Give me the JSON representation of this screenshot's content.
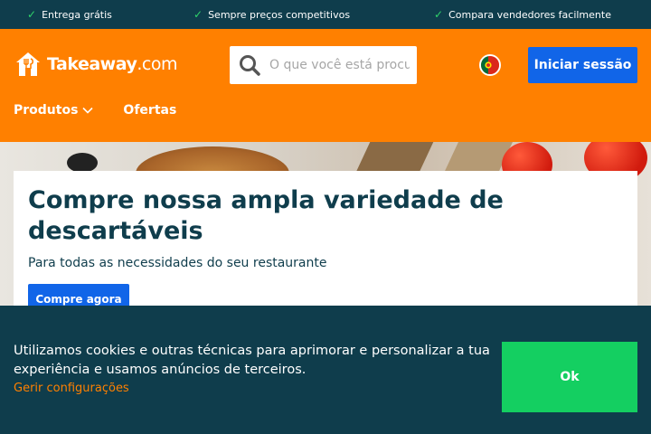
{
  "usp_bar": {
    "items": [
      {
        "icon": "check-icon",
        "label": "Entrega grátis"
      },
      {
        "icon": "check-icon",
        "label": "Sempre preços competitivos"
      },
      {
        "icon": "check-icon",
        "label": "Compara vendedores facilmente"
      }
    ]
  },
  "header": {
    "logo": {
      "brand": "Takeaway",
      "suffix": ".com"
    },
    "search": {
      "placeholder": "O que você está procurando?"
    },
    "flag": {
      "country": "Portugal"
    },
    "login_label": "Iniciar sessão"
  },
  "nav": {
    "items": [
      {
        "label": "Produtos",
        "icon": "chevron-down-icon"
      },
      {
        "label": "Ofertas"
      }
    ]
  },
  "hero": {
    "title": "Compre nossa ampla variedade de descartáveis",
    "subtitle": "Para todas as necessidades do seu restaurante",
    "cta_label": "Compre agora"
  },
  "cookie_banner": {
    "text": "Utilizamos cookies e outras técnicas para aprimorar e personalizar a tua experiência e usamos anúncios de terceiros.",
    "settings_link": "Gerir configurações",
    "ok_label": "Ok"
  },
  "colors": {
    "brand_orange": "#ff8000",
    "dark_teal": "#0f3d4c",
    "primary_blue": "#1165e8",
    "ok_green": "#14cf61",
    "check_green": "#2fd36a"
  }
}
